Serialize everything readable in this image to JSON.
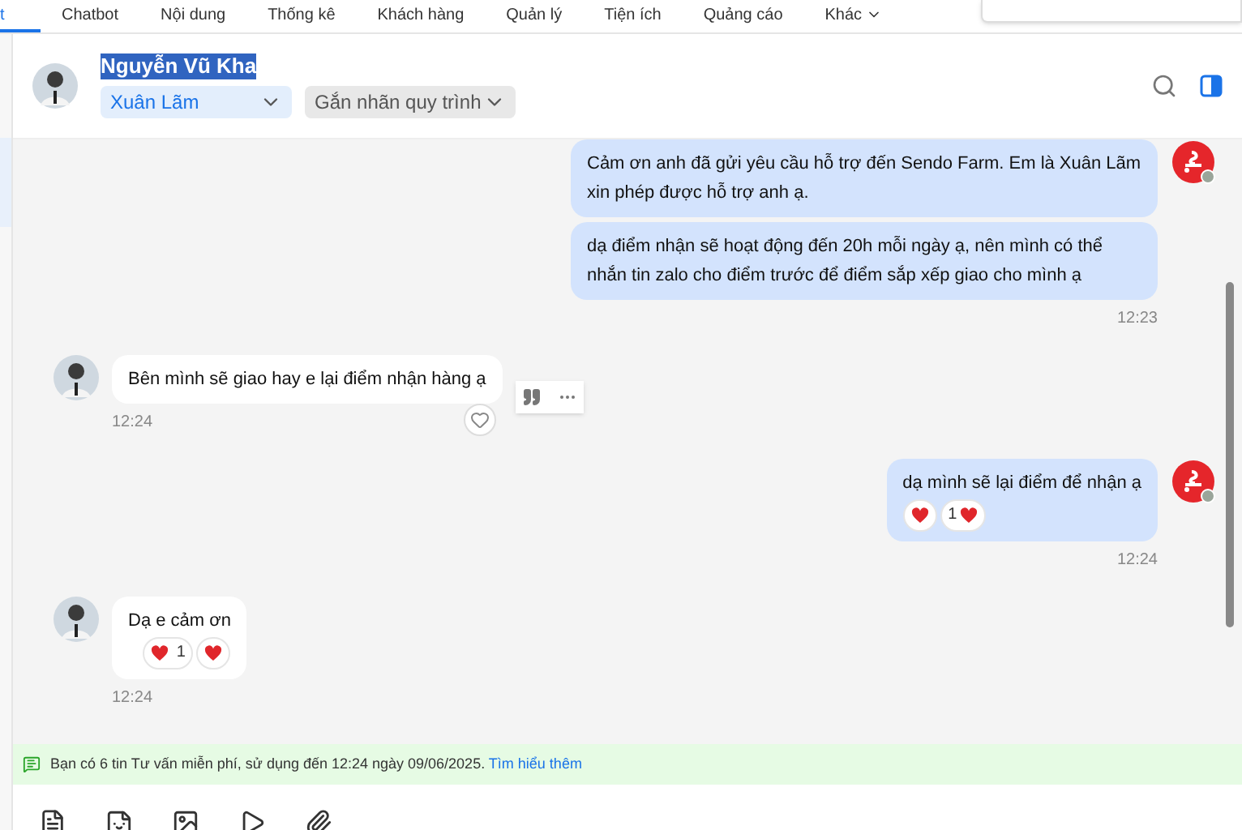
{
  "nav": {
    "tabs": [
      {
        "label": "t",
        "selected": true,
        "dropdown": false
      },
      {
        "label": "Chatbot",
        "selected": false,
        "dropdown": false
      },
      {
        "label": "Nội dung",
        "selected": false,
        "dropdown": false
      },
      {
        "label": "Thống kê",
        "selected": false,
        "dropdown": false
      },
      {
        "label": "Khách hàng",
        "selected": false,
        "dropdown": false
      },
      {
        "label": "Quản lý",
        "selected": false,
        "dropdown": false
      },
      {
        "label": "Tiện ích",
        "selected": false,
        "dropdown": false
      },
      {
        "label": "Quảng cáo",
        "selected": false,
        "dropdown": false
      },
      {
        "label": "Khác",
        "selected": false,
        "dropdown": true
      }
    ]
  },
  "header": {
    "name": "Nguyễn Vũ Kha",
    "name_selected": true,
    "assignee": "Xuân Lãm",
    "label_picker": "Gắn nhãn quy trình"
  },
  "messages": [
    {
      "kind": "outgoing",
      "bubbles": [
        "Cảm ơn anh đã gửi yêu cầu hỗ trợ đến Sendo Farm. Em là Xuân Lãm xin phép được hỗ trợ anh ạ.",
        "dạ điểm nhận sẽ hoạt động đến 20h mỗi ngày ạ, nên mình có thể nhắn tin zalo cho điểm trước để điểm sắp xếp giao cho mình ạ"
      ],
      "time": "12:23",
      "hovered": false
    },
    {
      "kind": "incoming",
      "bubbles": [
        "Bên mình sẽ giao hay e lại điểm nhận hàng ạ"
      ],
      "time": "12:24",
      "hovered": true
    },
    {
      "kind": "outgoing",
      "bubbles": [
        "dạ mình sẽ lại điểm để nhận ạ"
      ],
      "time": "12:24",
      "reactions": [
        {
          "kind": "heart"
        },
        {
          "kind": "count_heart",
          "count": "1"
        }
      ],
      "hovered": false
    },
    {
      "kind": "incoming",
      "bubbles": [
        "Dạ e cảm ơn"
      ],
      "time": "12:24",
      "reactions": [
        {
          "kind": "heart_count",
          "count": "1"
        },
        {
          "kind": "heart"
        }
      ],
      "hovered": false
    }
  ],
  "notice": {
    "text": "Bạn có 6 tin Tư vấn miễn phí, sử dụng đến 12:24 ngày 09/06/2025.",
    "link": "Tìm hiểu thêm"
  }
}
